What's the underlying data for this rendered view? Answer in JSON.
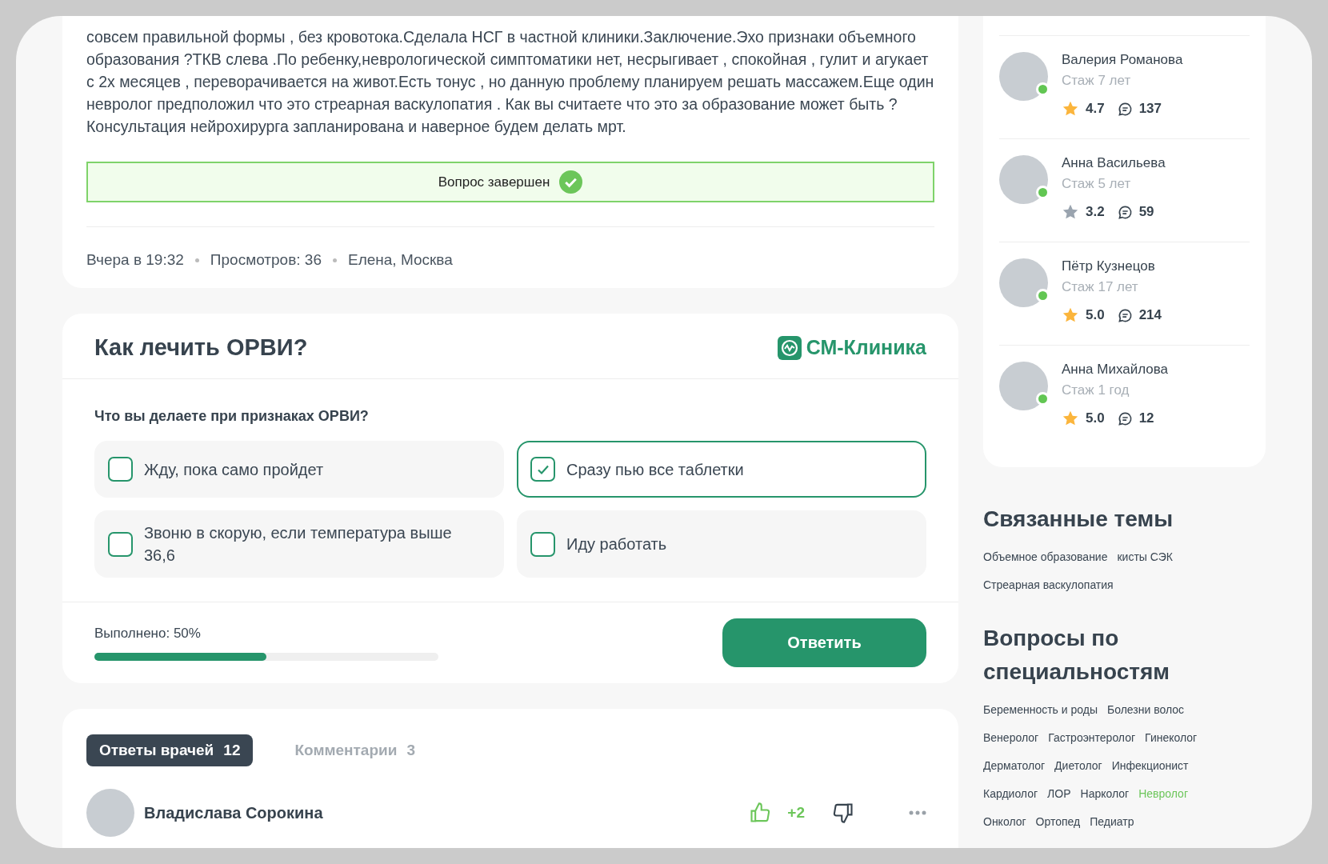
{
  "question": {
    "text": "совсем правильной формы , без кровотока.Сделала НСГ в частной клиники.Заключение.Эхо признаки объемного образования ?ТКВ слева .По ребенку,неврологической симптоматики нет, несрыгивает , спокойная , гулит и агукает с 2х месяцев , переворачивается на живот.Есть тонус , но данную проблему планируем решать массажем.Еще один невролог предположил что это стреарная васкулопатия . Как вы считаете что это за образование может быть ?Консультация нейрохирурга запланирована и наверное будем делать мрт.",
    "status": "Вопрос завершен",
    "completed": true,
    "meta": [
      "Вчера в 19:32",
      "Просмотров: 36",
      "Елена, Москва"
    ]
  },
  "quiz": {
    "title": "Как лечить ОРВИ?",
    "brand": "СМ-Клиника",
    "prompt": "Что вы делаете при признаках ОРВИ?",
    "options": [
      {
        "label": "Жду, пока само пройдет",
        "checked": false
      },
      {
        "label": "Сразу пью все таблетки",
        "checked": true
      },
      {
        "label": "Звоню в скорую, если температура выше 36,6",
        "checked": false
      },
      {
        "label": "Иду работать",
        "checked": false
      }
    ],
    "progress_label": "Выполнено: 50%",
    "level": 0.5,
    "submit": "Ответить"
  },
  "answers": {
    "tabs": [
      {
        "label": "Ответы врачей",
        "count": "12",
        "selected": true
      },
      {
        "label": "Комментарии",
        "count": "3",
        "selected": false
      }
    ],
    "first_answer": {
      "author": "Владислава Сорокина",
      "votes": "+2"
    }
  },
  "doctors": [
    {
      "name": "Валерия Романова",
      "experience": "Стаж 7 лет",
      "rating": "4.7",
      "highlighted": true,
      "online": true,
      "answers": "137"
    },
    {
      "name": "Анна Васильева",
      "experience": "Стаж 5 лет",
      "rating": "3.2",
      "highlighted": false,
      "online": true,
      "answers": "59"
    },
    {
      "name": "Пётр Кузнецов",
      "experience": "Стаж 17 лет",
      "rating": "5.0",
      "highlighted": true,
      "online": true,
      "answers": "214"
    },
    {
      "name": "Анна Михайлова",
      "experience": "Стаж 1 год",
      "rating": "5.0",
      "highlighted": true,
      "online": true,
      "answers": "12"
    }
  ],
  "related": {
    "title": "Связанные темы",
    "tags": [
      "Объемное образование",
      "кисты СЭК",
      "Стреарная васкулопатия"
    ]
  },
  "specialties": {
    "title": "Вопросы по специальностям",
    "tags": [
      {
        "label": "Беременность и роды",
        "selected": false
      },
      {
        "label": "Болезни волос",
        "selected": false
      },
      {
        "label": "Венеролог",
        "selected": false
      },
      {
        "label": "Гастроэнтеролог",
        "selected": false
      },
      {
        "label": "Гинеколог",
        "selected": false
      },
      {
        "label": "Дерматолог",
        "selected": false
      },
      {
        "label": "Диетолог",
        "selected": false
      },
      {
        "label": "Инфекционист",
        "selected": false
      },
      {
        "label": "Кардиолог",
        "selected": false
      },
      {
        "label": "ЛОР",
        "selected": false
      },
      {
        "label": "Нарколог",
        "selected": false
      },
      {
        "label": "Невролог",
        "selected": true
      },
      {
        "label": "Онколог",
        "selected": false
      },
      {
        "label": "Ортопед",
        "selected": false
      },
      {
        "label": "Педиатр",
        "selected": false
      }
    ]
  }
}
